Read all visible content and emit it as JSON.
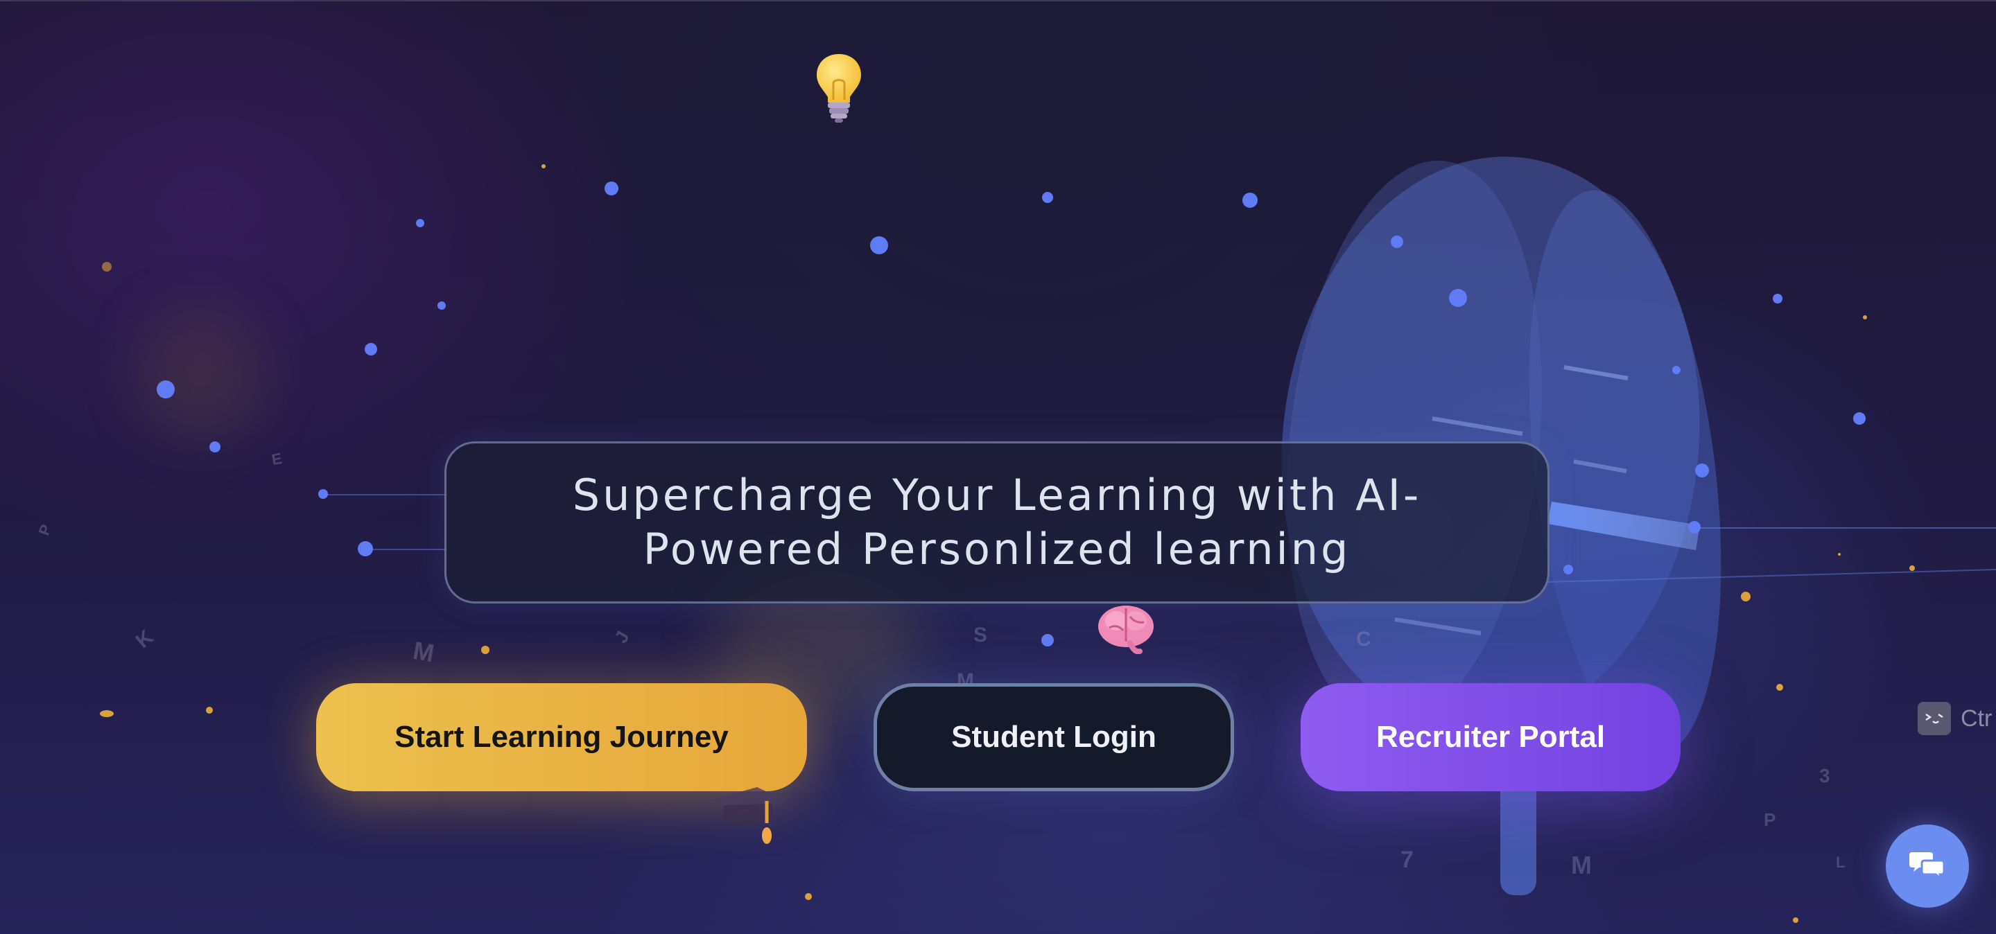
{
  "hero": {
    "title": "Supercharge Your Learning with AI-Powered Personlized learning"
  },
  "actions": {
    "start_label": "Start Learning Journey",
    "student_label": "Student Login",
    "recruiter_label": "Recruiter Portal"
  },
  "shortcut_hint": {
    "text": "Ctr"
  },
  "floating_letters": [
    "E",
    "P",
    "K",
    "M",
    "J",
    "S",
    "M",
    "C",
    "3",
    "P",
    "M",
    "7",
    "L"
  ],
  "icons": {
    "lightbulb": "lightbulb-icon",
    "brain": "brain-icon",
    "graduation_cap": "graduation-cap-icon",
    "chat": "chat-bubbles-icon",
    "terminal": "terminal-icon"
  },
  "colors": {
    "start_button": "#e9b444",
    "student_button": "#151a2a",
    "recruiter_button": "#8052e8",
    "chat_button": "#6b8df0",
    "particle_blue": "#5f7cf5",
    "particle_gold": "#d9a23a"
  }
}
